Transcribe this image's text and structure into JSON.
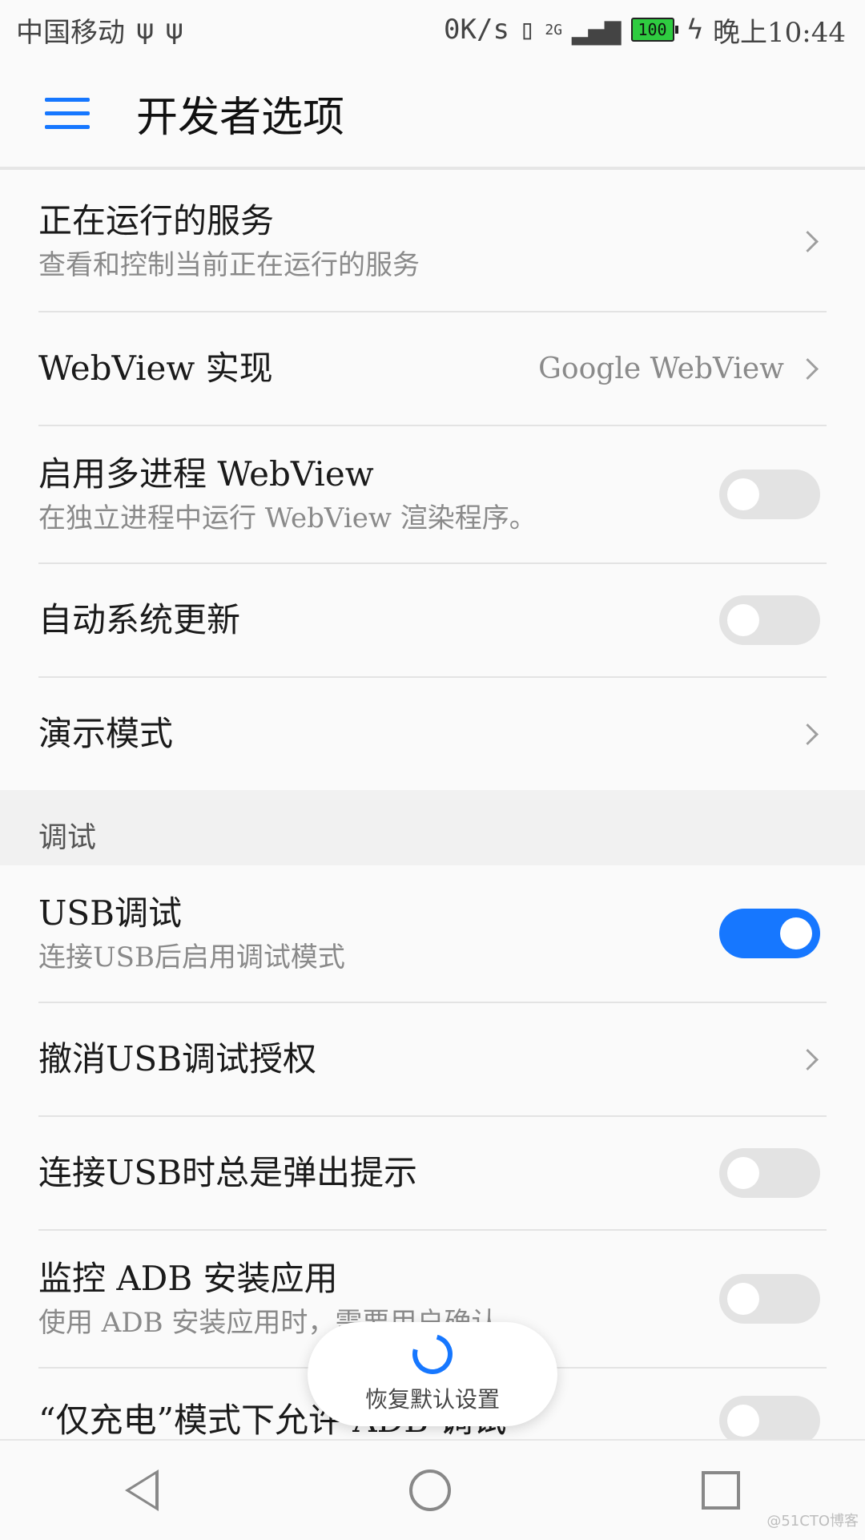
{
  "status_bar": {
    "carrier": "中国移动",
    "usb1": "ψ",
    "usb2": "ψ",
    "net_speed": "0K/s",
    "signal": "2G",
    "battery": "100",
    "time": "晚上10:44"
  },
  "appbar": {
    "title": "开发者选项",
    "menu_icon": "menu-icon"
  },
  "items": [
    {
      "title": "正在运行的服务",
      "subtitle": "查看和控制当前正在运行的服务",
      "control": "chevron"
    },
    {
      "title": "WebView 实现",
      "value": "Google WebView",
      "control": "chevron"
    },
    {
      "title": "启用多进程 WebView",
      "subtitle": "在独立进程中运行 WebView 渲染程序。",
      "control": "toggle",
      "on": false
    },
    {
      "title": "自动系统更新",
      "control": "toggle",
      "on": false
    },
    {
      "title": "演示模式",
      "control": "chevron"
    }
  ],
  "debug_section": {
    "header": "调试"
  },
  "debug_items": [
    {
      "title": "USB调试",
      "subtitle": "连接USB后启用调试模式",
      "control": "toggle",
      "on": true
    },
    {
      "title": "撤消USB调试授权",
      "control": "chevron"
    },
    {
      "title": "连接USB时总是弹出提示",
      "control": "toggle",
      "on": false
    },
    {
      "title": "监控 ADB 安装应用",
      "subtitle": "使用 ADB 安装应用时，需要用户确认",
      "control": "toggle",
      "on": false
    },
    {
      "title": "“仅充电”模式下允许 ADB 调试",
      "control": "toggle",
      "on": false
    }
  ],
  "restore_button": {
    "label": "恢复默认设置",
    "icon": "refresh-icon"
  },
  "watermark": "@51CTO博客",
  "colors": {
    "accent": "#1677ff",
    "toggle_off": "#e3e3e3"
  }
}
